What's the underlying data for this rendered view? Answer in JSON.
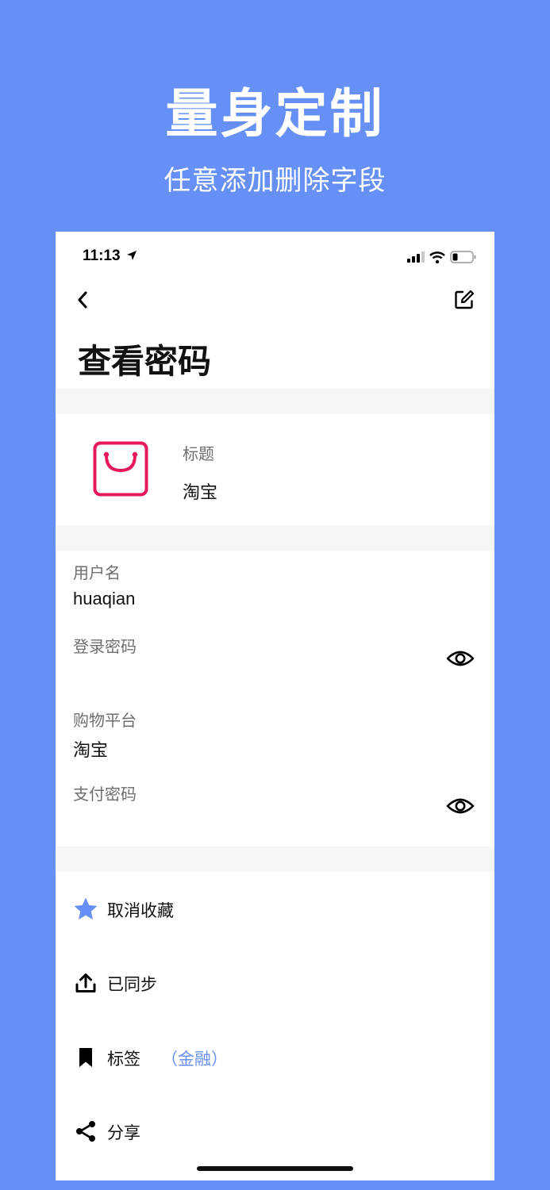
{
  "promo": {
    "headline": "量身定制",
    "subline": "任意添加删除字段"
  },
  "status_bar": {
    "time": "11:13"
  },
  "nav": {
    "back_icon": "chevron-left-icon",
    "edit_icon": "edit-icon",
    "title": "查看密码"
  },
  "entry": {
    "app_icon": "shopping-bag-icon",
    "title_label": "标题",
    "title_value": "淘宝"
  },
  "fields": [
    {
      "label": "用户名",
      "value": "huaqian"
    },
    {
      "label": "登录密码",
      "value": ""
    },
    {
      "label": "购物平台",
      "value": "淘宝"
    },
    {
      "label": "支付密码",
      "value": ""
    }
  ],
  "actions": {
    "favorite": {
      "label": "取消收藏",
      "icon": "star-icon",
      "color": "#6790f6"
    },
    "sync": {
      "label": "已同步",
      "icon": "upload-icon"
    },
    "tags": {
      "label": "标签",
      "icon": "bookmark-icon",
      "tag": "（金融）"
    },
    "share": {
      "label": "分享",
      "icon": "share-icon"
    }
  },
  "colors": {
    "background": "#6790f6",
    "accent": "#6790f6",
    "brand_icon": "#e8195a"
  }
}
